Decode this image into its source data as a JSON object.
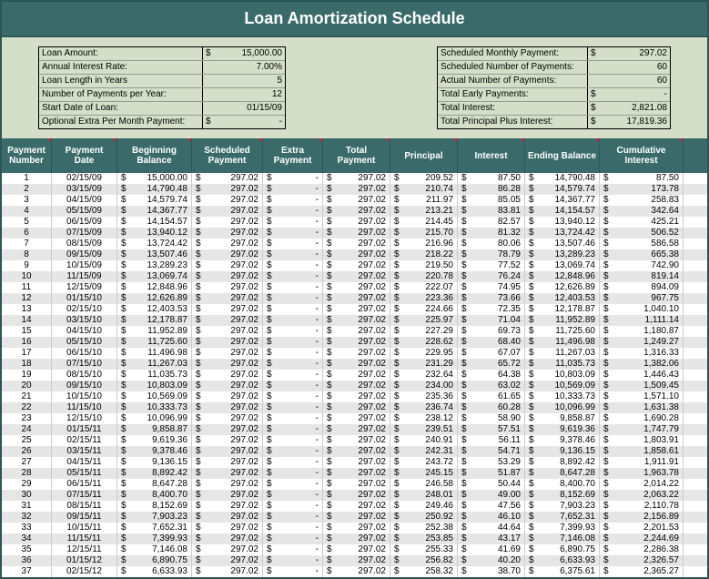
{
  "title": "Loan Amortization Schedule",
  "summary_left": [
    {
      "label": "Loan Amount:",
      "cur": "$",
      "val": "15,000.00"
    },
    {
      "label": "Annual Interest Rate:",
      "cur": "",
      "val": "7.00%"
    },
    {
      "label": "Loan Length in Years",
      "cur": "",
      "val": "5"
    },
    {
      "label": "Number of Payments per Year:",
      "cur": "",
      "val": "12"
    },
    {
      "label": "Start Date of Loan:",
      "cur": "",
      "val": "01/15/09"
    },
    {
      "label": "Optional Extra Per Month Payment:",
      "cur": "$",
      "val": "-"
    }
  ],
  "summary_right": [
    {
      "label": "Scheduled Monthly Payment:",
      "cur": "$",
      "val": "297.02"
    },
    {
      "label": "Scheduled Number of Payments:",
      "cur": "",
      "val": "60"
    },
    {
      "label": "Actual Number of Payments:",
      "cur": "",
      "val": "60"
    },
    {
      "label": "Total Early Payments:",
      "cur": "$",
      "val": "-"
    },
    {
      "label": "Total Interest:",
      "cur": "$",
      "val": "2,821.08"
    },
    {
      "label": "Total Principal Plus Interest:",
      "cur": "$",
      "val": "17,819.36"
    }
  ],
  "headers": {
    "num": "Payment Number",
    "date": "Payment Date",
    "bbal": "Beginning Balance",
    "sched": "Scheduled Payment",
    "extra": "Extra Payment",
    "total": "Total Payment",
    "prin": "Principal",
    "int": "Interest",
    "ebal": "Ending Balance",
    "cum": "Cumulative Interest"
  },
  "rows": [
    {
      "n": "1",
      "d": "02/15/09",
      "bb": "15,000.00",
      "sp": "297.02",
      "ep": "-",
      "tp": "297.02",
      "pr": "209.52",
      "in": "87.50",
      "eb": "14,790.48",
      "ci": "87.50"
    },
    {
      "n": "2",
      "d": "03/15/09",
      "bb": "14,790.48",
      "sp": "297.02",
      "ep": "-",
      "tp": "297.02",
      "pr": "210.74",
      "in": "86.28",
      "eb": "14,579.74",
      "ci": "173.78"
    },
    {
      "n": "3",
      "d": "04/15/09",
      "bb": "14,579.74",
      "sp": "297.02",
      "ep": "-",
      "tp": "297.02",
      "pr": "211.97",
      "in": "85.05",
      "eb": "14,367.77",
      "ci": "258.83"
    },
    {
      "n": "4",
      "d": "05/15/09",
      "bb": "14,367.77",
      "sp": "297.02",
      "ep": "-",
      "tp": "297.02",
      "pr": "213.21",
      "in": "83.81",
      "eb": "14,154.57",
      "ci": "342.64"
    },
    {
      "n": "5",
      "d": "06/15/09",
      "bb": "14,154.57",
      "sp": "297.02",
      "ep": "-",
      "tp": "297.02",
      "pr": "214.45",
      "in": "82.57",
      "eb": "13,940.12",
      "ci": "425.21"
    },
    {
      "n": "6",
      "d": "07/15/09",
      "bb": "13,940.12",
      "sp": "297.02",
      "ep": "-",
      "tp": "297.02",
      "pr": "215.70",
      "in": "81.32",
      "eb": "13,724.42",
      "ci": "506.52"
    },
    {
      "n": "7",
      "d": "08/15/09",
      "bb": "13,724.42",
      "sp": "297.02",
      "ep": "-",
      "tp": "297.02",
      "pr": "216.96",
      "in": "80.06",
      "eb": "13,507.46",
      "ci": "586.58"
    },
    {
      "n": "8",
      "d": "09/15/09",
      "bb": "13,507.46",
      "sp": "297.02",
      "ep": "-",
      "tp": "297.02",
      "pr": "218.22",
      "in": "78.79",
      "eb": "13,289.23",
      "ci": "665.38"
    },
    {
      "n": "9",
      "d": "10/15/09",
      "bb": "13,289.23",
      "sp": "297.02",
      "ep": "-",
      "tp": "297.02",
      "pr": "219.50",
      "in": "77.52",
      "eb": "13,069.74",
      "ci": "742.90"
    },
    {
      "n": "10",
      "d": "11/15/09",
      "bb": "13,069.74",
      "sp": "297.02",
      "ep": "-",
      "tp": "297.02",
      "pr": "220.78",
      "in": "76.24",
      "eb": "12,848.96",
      "ci": "819.14"
    },
    {
      "n": "11",
      "d": "12/15/09",
      "bb": "12,848.96",
      "sp": "297.02",
      "ep": "-",
      "tp": "297.02",
      "pr": "222.07",
      "in": "74.95",
      "eb": "12,626.89",
      "ci": "894.09"
    },
    {
      "n": "12",
      "d": "01/15/10",
      "bb": "12,626.89",
      "sp": "297.02",
      "ep": "-",
      "tp": "297.02",
      "pr": "223.36",
      "in": "73.66",
      "eb": "12,403.53",
      "ci": "967.75"
    },
    {
      "n": "13",
      "d": "02/15/10",
      "bb": "12,403.53",
      "sp": "297.02",
      "ep": "-",
      "tp": "297.02",
      "pr": "224.66",
      "in": "72.35",
      "eb": "12,178.87",
      "ci": "1,040.10"
    },
    {
      "n": "14",
      "d": "03/15/10",
      "bb": "12,178.87",
      "sp": "297.02",
      "ep": "-",
      "tp": "297.02",
      "pr": "225.97",
      "in": "71.04",
      "eb": "11,952.89",
      "ci": "1,111.14"
    },
    {
      "n": "15",
      "d": "04/15/10",
      "bb": "11,952.89",
      "sp": "297.02",
      "ep": "-",
      "tp": "297.02",
      "pr": "227.29",
      "in": "69.73",
      "eb": "11,725.60",
      "ci": "1,180.87"
    },
    {
      "n": "16",
      "d": "05/15/10",
      "bb": "11,725.60",
      "sp": "297.02",
      "ep": "-",
      "tp": "297.02",
      "pr": "228.62",
      "in": "68.40",
      "eb": "11,496.98",
      "ci": "1,249.27"
    },
    {
      "n": "17",
      "d": "06/15/10",
      "bb": "11,496.98",
      "sp": "297.02",
      "ep": "-",
      "tp": "297.02",
      "pr": "229.95",
      "in": "67.07",
      "eb": "11,267.03",
      "ci": "1,316.33"
    },
    {
      "n": "18",
      "d": "07/15/10",
      "bb": "11,267.03",
      "sp": "297.02",
      "ep": "-",
      "tp": "297.02",
      "pr": "231.29",
      "in": "65.72",
      "eb": "11,035.73",
      "ci": "1,382.06"
    },
    {
      "n": "19",
      "d": "08/15/10",
      "bb": "11,035.73",
      "sp": "297.02",
      "ep": "-",
      "tp": "297.02",
      "pr": "232.64",
      "in": "64.38",
      "eb": "10,803.09",
      "ci": "1,446.43"
    },
    {
      "n": "20",
      "d": "09/15/10",
      "bb": "10,803.09",
      "sp": "297.02",
      "ep": "-",
      "tp": "297.02",
      "pr": "234.00",
      "in": "63.02",
      "eb": "10,569.09",
      "ci": "1,509.45"
    },
    {
      "n": "21",
      "d": "10/15/10",
      "bb": "10,569.09",
      "sp": "297.02",
      "ep": "-",
      "tp": "297.02",
      "pr": "235.36",
      "in": "61.65",
      "eb": "10,333.73",
      "ci": "1,571.10"
    },
    {
      "n": "22",
      "d": "11/15/10",
      "bb": "10,333.73",
      "sp": "297.02",
      "ep": "-",
      "tp": "297.02",
      "pr": "236.74",
      "in": "60.28",
      "eb": "10,096.99",
      "ci": "1,631.38"
    },
    {
      "n": "23",
      "d": "12/15/10",
      "bb": "10,096.99",
      "sp": "297.02",
      "ep": "-",
      "tp": "297.02",
      "pr": "238.12",
      "in": "58.90",
      "eb": "9,858.87",
      "ci": "1,690.28"
    },
    {
      "n": "24",
      "d": "01/15/11",
      "bb": "9,858.87",
      "sp": "297.02",
      "ep": "-",
      "tp": "297.02",
      "pr": "239.51",
      "in": "57.51",
      "eb": "9,619.36",
      "ci": "1,747.79"
    },
    {
      "n": "25",
      "d": "02/15/11",
      "bb": "9,619.36",
      "sp": "297.02",
      "ep": "-",
      "tp": "297.02",
      "pr": "240.91",
      "in": "56.11",
      "eb": "9,378.46",
      "ci": "1,803.91"
    },
    {
      "n": "26",
      "d": "03/15/11",
      "bb": "9,378.46",
      "sp": "297.02",
      "ep": "-",
      "tp": "297.02",
      "pr": "242.31",
      "in": "54.71",
      "eb": "9,136.15",
      "ci": "1,858.61"
    },
    {
      "n": "27",
      "d": "04/15/11",
      "bb": "9,136.15",
      "sp": "297.02",
      "ep": "-",
      "tp": "297.02",
      "pr": "243.72",
      "in": "53.29",
      "eb": "8,892.42",
      "ci": "1,911.91"
    },
    {
      "n": "28",
      "d": "05/15/11",
      "bb": "8,892.42",
      "sp": "297.02",
      "ep": "-",
      "tp": "297.02",
      "pr": "245.15",
      "in": "51.87",
      "eb": "8,647.28",
      "ci": "1,963.78"
    },
    {
      "n": "29",
      "d": "06/15/11",
      "bb": "8,647.28",
      "sp": "297.02",
      "ep": "-",
      "tp": "297.02",
      "pr": "246.58",
      "in": "50.44",
      "eb": "8,400.70",
      "ci": "2,014.22"
    },
    {
      "n": "30",
      "d": "07/15/11",
      "bb": "8,400.70",
      "sp": "297.02",
      "ep": "-",
      "tp": "297.02",
      "pr": "248.01",
      "in": "49.00",
      "eb": "8,152.69",
      "ci": "2,063.22"
    },
    {
      "n": "31",
      "d": "08/15/11",
      "bb": "8,152.69",
      "sp": "297.02",
      "ep": "-",
      "tp": "297.02",
      "pr": "249.46",
      "in": "47.56",
      "eb": "7,903.23",
      "ci": "2,110.78"
    },
    {
      "n": "32",
      "d": "09/15/11",
      "bb": "7,903.23",
      "sp": "297.02",
      "ep": "-",
      "tp": "297.02",
      "pr": "250.92",
      "in": "46.10",
      "eb": "7,652.31",
      "ci": "2,156.89"
    },
    {
      "n": "33",
      "d": "10/15/11",
      "bb": "7,652.31",
      "sp": "297.02",
      "ep": "-",
      "tp": "297.02",
      "pr": "252.38",
      "in": "44.64",
      "eb": "7,399.93",
      "ci": "2,201.53"
    },
    {
      "n": "34",
      "d": "11/15/11",
      "bb": "7,399.93",
      "sp": "297.02",
      "ep": "-",
      "tp": "297.02",
      "pr": "253.85",
      "in": "43.17",
      "eb": "7,146.08",
      "ci": "2,244.69"
    },
    {
      "n": "35",
      "d": "12/15/11",
      "bb": "7,146.08",
      "sp": "297.02",
      "ep": "-",
      "tp": "297.02",
      "pr": "255.33",
      "in": "41.69",
      "eb": "6,890.75",
      "ci": "2,286.38"
    },
    {
      "n": "36",
      "d": "01/15/12",
      "bb": "6,890.75",
      "sp": "297.02",
      "ep": "-",
      "tp": "297.02",
      "pr": "256.82",
      "in": "40.20",
      "eb": "6,633.93",
      "ci": "2,326.57"
    },
    {
      "n": "37",
      "d": "02/15/12",
      "bb": "6,633.93",
      "sp": "297.02",
      "ep": "-",
      "tp": "297.02",
      "pr": "258.32",
      "in": "38.70",
      "eb": "6,375.61",
      "ci": "2,365.27"
    }
  ]
}
